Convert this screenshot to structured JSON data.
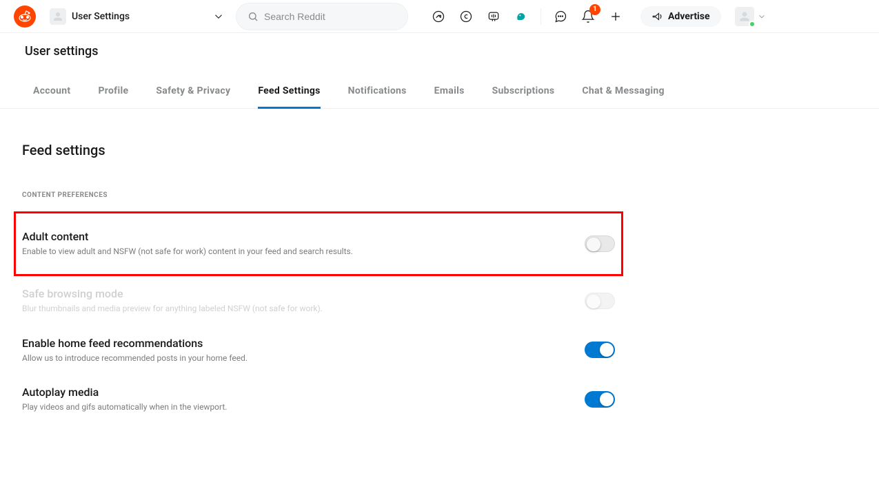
{
  "header": {
    "user_dropdown_label": "User Settings",
    "search_placeholder": "Search Reddit",
    "notification_count": "1",
    "advertise_label": "Advertise"
  },
  "page": {
    "heading": "User settings"
  },
  "tabs": [
    {
      "label": "Account",
      "active": false
    },
    {
      "label": "Profile",
      "active": false
    },
    {
      "label": "Safety & Privacy",
      "active": false
    },
    {
      "label": "Feed Settings",
      "active": true
    },
    {
      "label": "Notifications",
      "active": false
    },
    {
      "label": "Emails",
      "active": false
    },
    {
      "label": "Subscriptions",
      "active": false
    },
    {
      "label": "Chat & Messaging",
      "active": false
    }
  ],
  "section": {
    "title": "Feed settings",
    "category": "CONTENT PREFERENCES"
  },
  "settings": {
    "adult_content": {
      "title": "Adult content",
      "desc": "Enable to view adult and NSFW (not safe for work) content in your feed and search results.",
      "on": false,
      "highlighted": true,
      "disabled": false
    },
    "safe_browsing": {
      "title": "Safe browsing mode",
      "desc": "Blur thumbnails and media preview for anything labeled NSFW (not safe for work).",
      "on": false,
      "disabled": true
    },
    "home_feed_recs": {
      "title": "Enable home feed recommendations",
      "desc": "Allow us to introduce recommended posts in your home feed.",
      "on": true,
      "disabled": false
    },
    "autoplay": {
      "title": "Autoplay media",
      "desc": "Play videos and gifs automatically when in the viewport.",
      "on": true,
      "disabled": false
    }
  }
}
